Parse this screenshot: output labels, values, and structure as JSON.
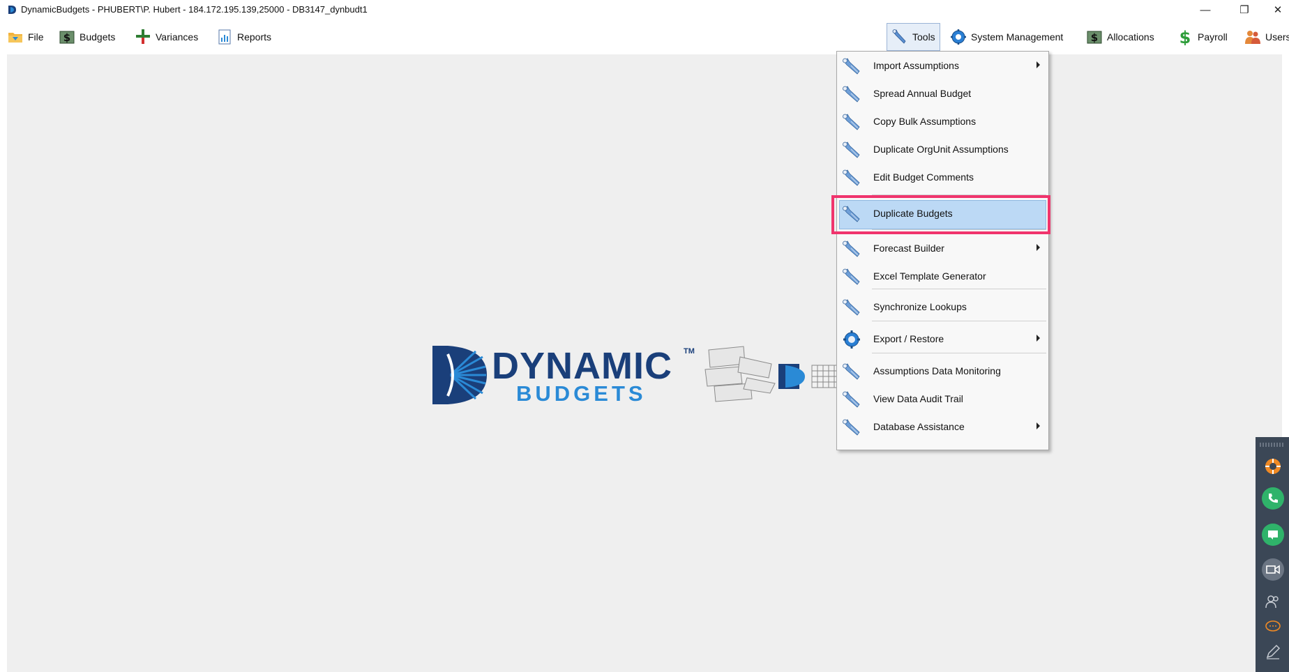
{
  "window": {
    "title": "DynamicBudgets - PHUBERT\\P. Hubert - 184.172.195.139,25000 - DB3147_dynbudt1",
    "minimize_glyph": "—",
    "restore_glyph": "❐",
    "close_glyph": "✕"
  },
  "menubar": {
    "left": [
      {
        "label": "File",
        "icon": "folder-icon"
      },
      {
        "label": "Budgets",
        "icon": "dollar-icon"
      },
      {
        "label": "Variances",
        "icon": "plus-minus-icon"
      },
      {
        "label": "Reports",
        "icon": "report-icon"
      }
    ],
    "right": [
      {
        "label": "Tools",
        "icon": "wrench-icon"
      },
      {
        "label": "System Management",
        "icon": "gear-icon"
      },
      {
        "label": "Allocations",
        "icon": "dollar-icon"
      },
      {
        "label": "Payroll",
        "icon": "money-icon"
      },
      {
        "label": "Users Management",
        "icon": "users-icon"
      }
    ]
  },
  "logo": {
    "line1": "DYNAMIC",
    "tm": "TM",
    "line2": "BUDGETS"
  },
  "tools_menu": {
    "items": [
      {
        "label": "Import Assumptions",
        "icon": "wrench-icon",
        "submenu": true
      },
      {
        "label": "Spread Annual Budget",
        "icon": "wrench-icon",
        "submenu": false
      },
      {
        "label": "Copy Bulk Assumptions",
        "icon": "wrench-icon",
        "submenu": false
      },
      {
        "label": "Duplicate OrgUnit Assumptions",
        "icon": "wrench-icon",
        "submenu": false
      },
      {
        "label": "Edit Budget Comments",
        "icon": "wrench-icon",
        "submenu": false
      },
      {
        "label": "Duplicate Budgets",
        "icon": "wrench-icon",
        "submenu": false,
        "highlighted": true
      },
      {
        "label": "Forecast Builder",
        "icon": "wrench-icon",
        "submenu": true
      },
      {
        "label": "Excel Template Generator",
        "icon": "wrench-icon",
        "submenu": false
      },
      {
        "label": "Synchronize Lookups",
        "icon": "wrench-icon",
        "submenu": false
      },
      {
        "label": "Export / Restore",
        "icon": "gear-icon",
        "submenu": true
      },
      {
        "label": "Assumptions Data Monitoring",
        "icon": "wrench-icon",
        "submenu": false
      },
      {
        "label": "View Data Audit Trail",
        "icon": "wrench-icon",
        "submenu": false
      },
      {
        "label": "Database Assistance",
        "icon": "wrench-icon",
        "submenu": true
      }
    ]
  },
  "side_panel": {
    "buttons": [
      "help-icon",
      "phone-icon",
      "chat-icon",
      "video-icon",
      "people-icon",
      "message-icon",
      "pen-icon"
    ]
  },
  "colors": {
    "highlight_border": "#f0346d",
    "selection_bg": "#bcd9f5",
    "workspace_bg": "#efefef",
    "brand_dark": "#1a3f7a",
    "brand_light": "#2a8ad6"
  }
}
